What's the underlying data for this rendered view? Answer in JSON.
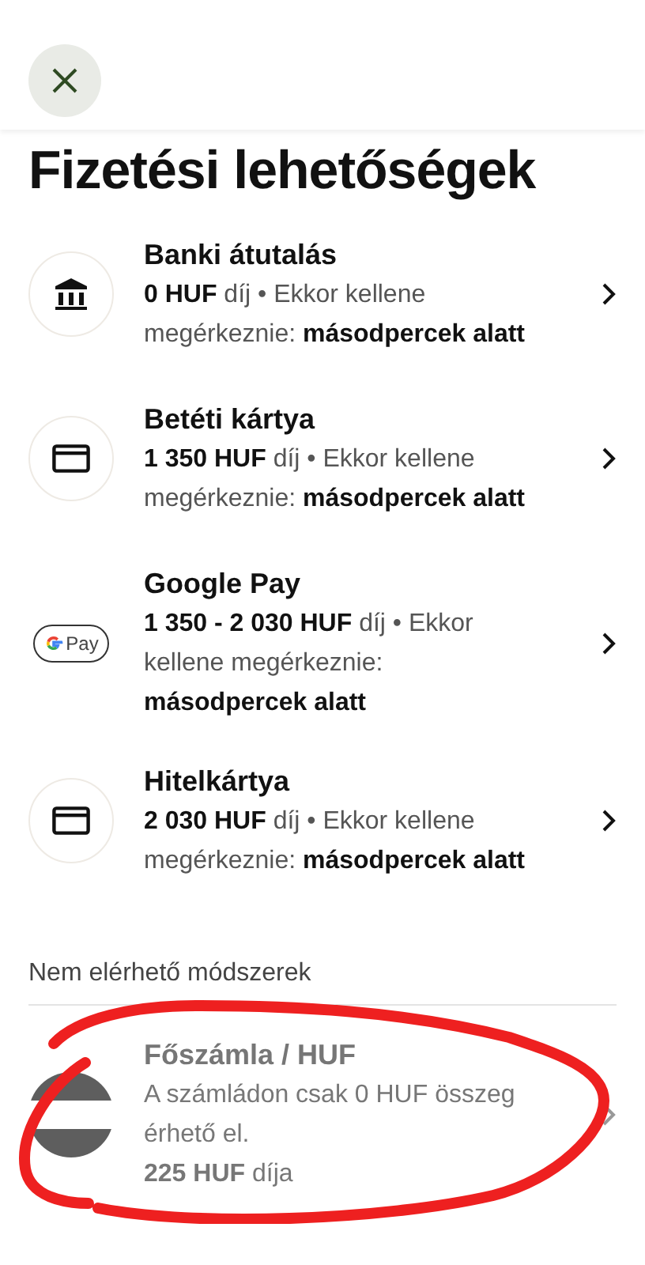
{
  "title": "Fizetési lehetőségek",
  "methods": [
    {
      "kind": "bank",
      "name": "Banki átutalás",
      "description": "**0 HUF** díj • Ekkor kellene megérkeznie: **másodpercek alatt**"
    },
    {
      "kind": "card",
      "name": "Betéti kártya",
      "description": "**1 350 HUF** díj • Ekkor kellene megérkeznie: **másodpercek alatt**"
    },
    {
      "kind": "gpay",
      "name": "Google Pay",
      "logo_text": "Pay",
      "description": "**1 350 - 2 030 HUF** díj • Ekkor kellene megérkeznie: **másodpercek alatt**"
    },
    {
      "kind": "card",
      "name": "Hitelkártya",
      "description": "**2 030 HUF** díj • Ekkor kellene megérkeznie: **másodpercek alatt**"
    }
  ],
  "unavailable": {
    "heading": "Nem elérhető módszerek",
    "items": [
      {
        "kind": "flag",
        "name": "Főszámla / HUF",
        "disabled": true,
        "description": "A számládon csak 0 HUF összeg érhető el.",
        "fee": "**225 HUF** díja",
        "annotated": true
      }
    ]
  }
}
